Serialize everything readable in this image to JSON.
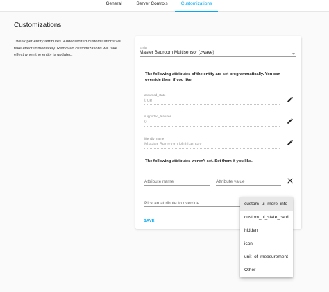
{
  "tabs": [
    {
      "label": "General",
      "active": false
    },
    {
      "label": "Server Controls",
      "active": false
    },
    {
      "label": "Customizations",
      "active": true
    }
  ],
  "page": {
    "title": "Customizations",
    "intro": "Tweak per-entity attributes. Added/edited customizations will take effect immediately. Removed customizations will take effect when the entity is updated."
  },
  "entity": {
    "label": "Entity",
    "value": "Master Bedroom Multisensor (zwave)"
  },
  "programmatic": {
    "note": "The following attributes of the entity are set programmatically. You can override them if you like.",
    "attributes": [
      {
        "name": "assumed_state",
        "value": "true",
        "icon": "edit-icon"
      },
      {
        "name": "supported_features",
        "value": "0",
        "icon": "edit-icon"
      },
      {
        "name": "friendly_name",
        "value": "Master Bedroom Multisensor",
        "icon": "edit-icon"
      }
    ]
  },
  "unset": {
    "note": "The following attributes weren't set. Set them if you like.",
    "name_placeholder": "Attribute name",
    "value_placeholder": "Attribute value"
  },
  "picker": {
    "placeholder": "Pick an attribute to override"
  },
  "save_label": "SAVE",
  "dropdown": {
    "items": [
      {
        "label": "custom_ui_more_info",
        "selected": true
      },
      {
        "label": "custom_ui_state_card",
        "selected": false
      },
      {
        "label": "hidden",
        "selected": false
      },
      {
        "label": "icon",
        "selected": false
      },
      {
        "label": "unit_of_measurement",
        "selected": false
      },
      {
        "label": "Other",
        "selected": false
      }
    ]
  },
  "colors": {
    "accent": "#03a9f4",
    "text": "#212121",
    "disabled": "#a5a5a5"
  }
}
